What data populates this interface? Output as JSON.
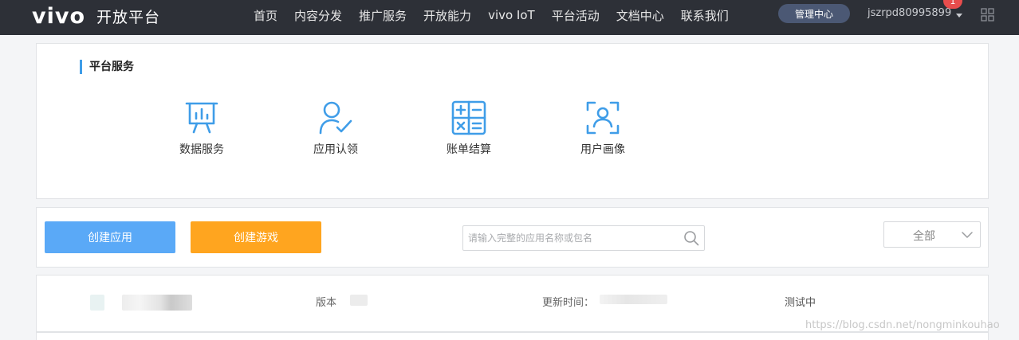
{
  "header": {
    "logo_text": "vivo",
    "logo_subtitle": "开放平台",
    "nav_items": [
      "首页",
      "内容分发",
      "推广服务",
      "开放能力",
      "vivo IoT",
      "平台活动",
      "文档中心",
      "联系我们"
    ],
    "manage_button": "管理中心",
    "username": "jszrpd80995899",
    "notification_count": "1"
  },
  "services": {
    "title": "平台服务",
    "items": [
      {
        "label": "数据服务",
        "icon": "data-chart-icon"
      },
      {
        "label": "应用认领",
        "icon": "user-check-icon"
      },
      {
        "label": "账单结算",
        "icon": "calculator-icon"
      },
      {
        "label": "用户画像",
        "icon": "user-scan-icon"
      }
    ]
  },
  "toolbar": {
    "create_app": "创建应用",
    "create_game": "创建游戏",
    "search_placeholder": "请输入完整的应用名称或包名",
    "filter_value": "全部"
  },
  "app_row": {
    "version_label": "版本",
    "updated_label": "更新时间：",
    "status": "测试中"
  },
  "watermark": "https://blog.csdn.net/nongminkouhao",
  "colors": {
    "topbar": "#2d3037",
    "accent_blue": "#5aa9f7",
    "accent_orange": "#ffa51f",
    "icon_blue": "#3f9de8",
    "badge_red": "#e84d4d"
  }
}
